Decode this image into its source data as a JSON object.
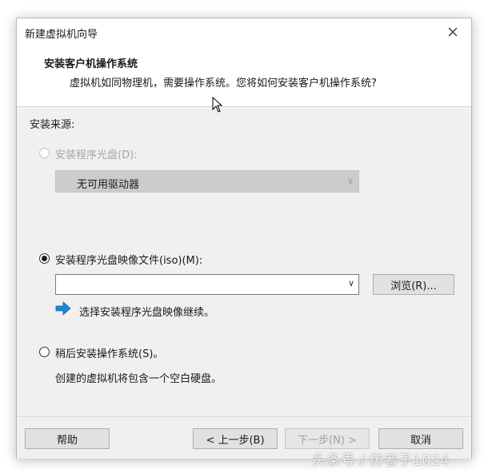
{
  "window": {
    "title": "新建虚拟机向导"
  },
  "header": {
    "title": "安装客户机操作系统",
    "subtitle": "虚拟机如同物理机，需要操作系统。您将如何安装客户机操作系统?"
  },
  "install_source": {
    "label": "安装来源:",
    "options": [
      {
        "label": "安装程序光盘(D):",
        "selected": false,
        "enabled": false
      },
      {
        "label": "安装程序光盘映像文件(iso)(M):",
        "selected": true,
        "enabled": true
      },
      {
        "label": "稍后安装操作系统(S)。",
        "selected": false,
        "enabled": true
      }
    ],
    "drive_select": {
      "value": "无可用驱动器",
      "enabled": false
    },
    "iso_path": {
      "value": ""
    },
    "browse_label": "浏览(R)...",
    "hint": "选择安装程序光盘映像继续。",
    "later_description": "创建的虚拟机将包含一个空白硬盘。"
  },
  "footer": {
    "help_label": "帮助",
    "back_label": "< 上一步(B)",
    "next_label": "下一步(N) >",
    "cancel_label": "取消"
  },
  "icons": {
    "close": "close-icon",
    "arrow": "arrow-right-icon",
    "chevron": "chevron-down-icon"
  },
  "colors": {
    "hint_arrow": "#1e88d8",
    "dialog_bg": "#f0f0f0"
  },
  "watermark": "头条号 / 仿者子1024"
}
